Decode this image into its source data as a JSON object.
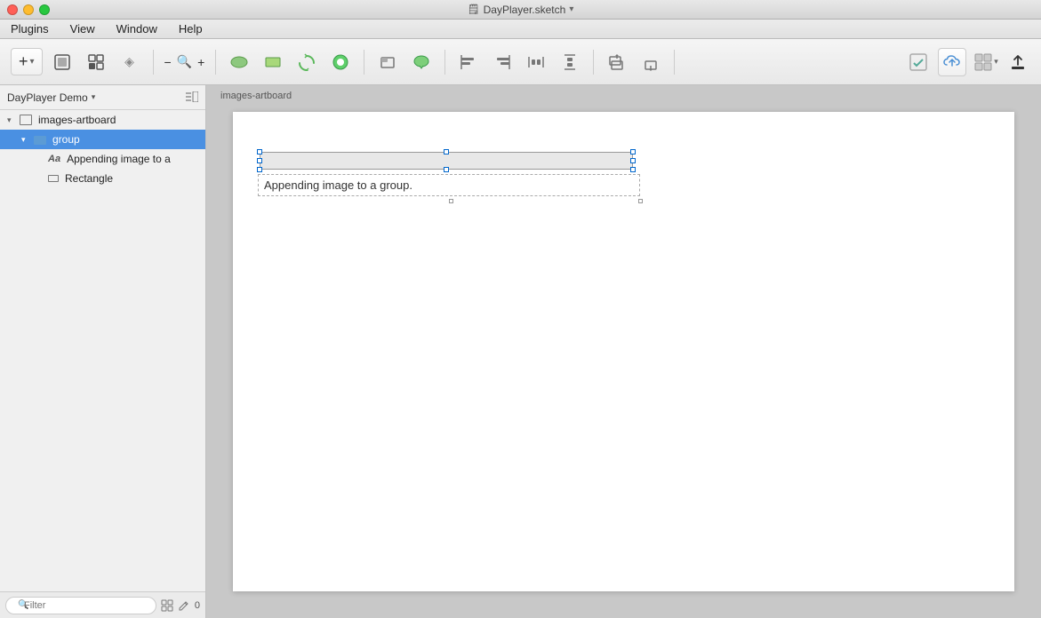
{
  "titlebar": {
    "filename": "DayPlayer.sketch",
    "dropdown_arrow": "▾"
  },
  "menubar": {
    "items": [
      "Plugins",
      "View",
      "Window",
      "Help"
    ]
  },
  "toolbar": {
    "insert_label": "+",
    "insert_arrow": "▾",
    "zoom_minus": "−",
    "zoom_icon": "🔍",
    "zoom_plus": "+",
    "tools": [
      {
        "name": "oval-tool",
        "icon": "⬭"
      },
      {
        "name": "rectangle-tool",
        "icon": "▭"
      },
      {
        "name": "rotate-tool",
        "icon": "↺"
      },
      {
        "name": "vector-tool",
        "icon": "⬠"
      }
    ],
    "arrange_tools": [
      {
        "name": "frame-tool",
        "icon": "▣"
      },
      {
        "name": "speech-bubble-tool",
        "icon": "💬"
      }
    ],
    "align_left": "⇤",
    "align_right": "⇥",
    "distribute_h": "⇔",
    "distribute_v": "⇕",
    "scale_up": "↑",
    "scale_down": "↓",
    "checkbox_tool": "☑",
    "cloud_upload": "☁",
    "layout_btn": "⊞",
    "export_btn": "↑",
    "inspector_label": "⊞▾"
  },
  "sidebar": {
    "project_name": "DayPlayer Demo",
    "chevron": "▾",
    "collapse_icon": "≡",
    "layers": [
      {
        "id": "artboard",
        "label": "images-artboard",
        "indent": 1,
        "type": "artboard",
        "expanded": true,
        "selected": false
      },
      {
        "id": "group",
        "label": "group",
        "indent": 2,
        "type": "folder",
        "expanded": true,
        "selected": true
      },
      {
        "id": "text",
        "label": "Appending image to a",
        "indent": 3,
        "type": "text",
        "selected": false
      },
      {
        "id": "rect",
        "label": "Rectangle",
        "indent": 3,
        "type": "rectangle",
        "selected": false
      }
    ]
  },
  "sidebar_footer": {
    "filter_placeholder": "Filter",
    "search_icon": "🔍",
    "grid_icon": "⊞",
    "pencil_icon": "✏",
    "count": "0"
  },
  "canvas": {
    "breadcrumb": "images-artboard"
  },
  "artboard_content": {
    "rectangle_element": "Rectangle",
    "text_element": "Appending image to a group."
  },
  "colors": {
    "sidebar_bg": "#f0f0f0",
    "canvas_bg": "#c8c8c8",
    "artboard_bg": "#ffffff",
    "selected_row": "#4a90e2",
    "toolbar_bg": "#efefef"
  }
}
